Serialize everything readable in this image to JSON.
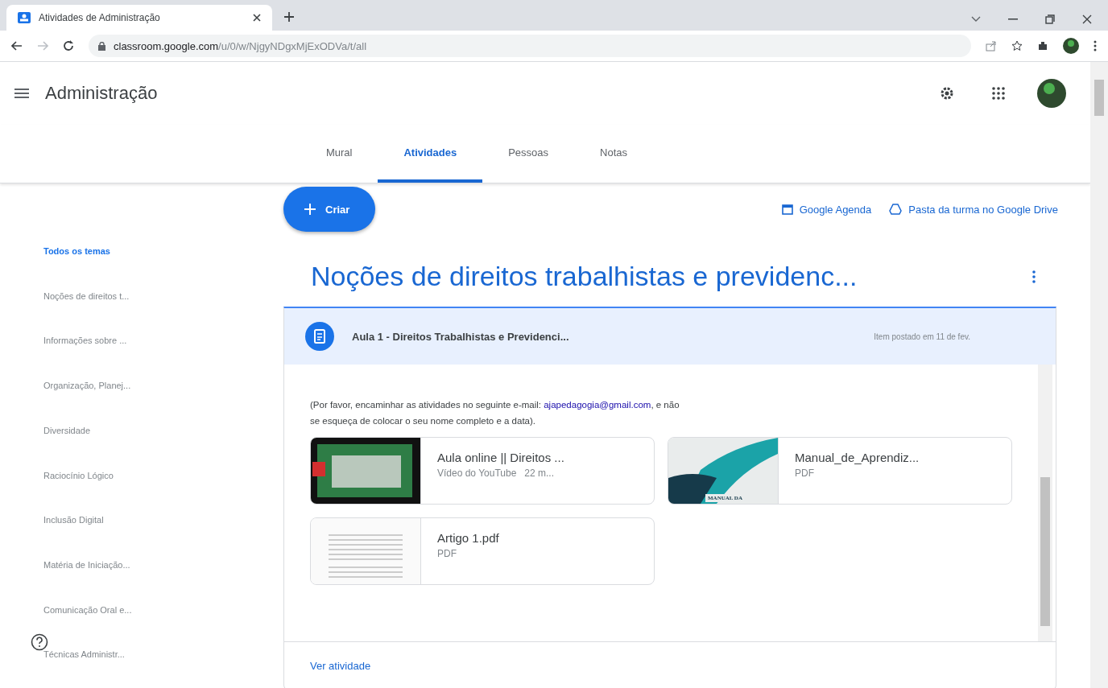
{
  "browser": {
    "tab_title": "Atividades de Administração",
    "url_domain": "classroom.google.com",
    "url_path": "/u/0/w/NjgyNDgxMjExODVa/t/all"
  },
  "header": {
    "title": "Administração"
  },
  "nav_tabs": [
    {
      "label": "Mural",
      "selected": false
    },
    {
      "label": "Atividades",
      "selected": true
    },
    {
      "label": "Pessoas",
      "selected": false
    },
    {
      "label": "Notas",
      "selected": false
    }
  ],
  "toolbar": {
    "create_label": "Criar",
    "calendar_link": "Google Agenda",
    "drive_link": "Pasta da turma no Google Drive"
  },
  "sidebar": {
    "topics": [
      {
        "label": "Todos os temas",
        "selected": true
      },
      {
        "label": "Noções de direitos t...",
        "selected": false
      },
      {
        "label": "Informações sobre ...",
        "selected": false
      },
      {
        "label": "Organização, Planej...",
        "selected": false
      },
      {
        "label": "Diversidade",
        "selected": false
      },
      {
        "label": "Raciocínio Lógico",
        "selected": false
      },
      {
        "label": "Inclusão Digital",
        "selected": false
      },
      {
        "label": "Matéria de Iniciação...",
        "selected": false
      },
      {
        "label": "Comunicação Oral e...",
        "selected": false
      },
      {
        "label": "Técnicas Administr...",
        "selected": false
      }
    ]
  },
  "topic": {
    "title": "Noções de direitos trabalhistas e previdenc...",
    "post": {
      "title": "Aula 1 - Direitos Trabalhistas e Previdenci...",
      "date": "Item postado em 11 de fev.",
      "body_before": "(Por favor, encaminhar as atividades no seguinte e-mail: ",
      "body_link": "ajapedagogia@gmail.com",
      "body_after": ", e não se esqueça de colocar o seu nome completo e a data).",
      "attachments": [
        {
          "kind": "video",
          "title": "Aula online || Direitos ...",
          "subtitle": "Vídeo do YouTube   22 m..."
        },
        {
          "kind": "pdf-cover",
          "title": "Manual_de_Aprendiz...",
          "subtitle": "PDF",
          "cover_text": "MANUAL DA"
        },
        {
          "kind": "pdf",
          "title": "Artigo 1.pdf",
          "subtitle": "PDF"
        }
      ],
      "footer_link": "Ver atividade"
    }
  }
}
